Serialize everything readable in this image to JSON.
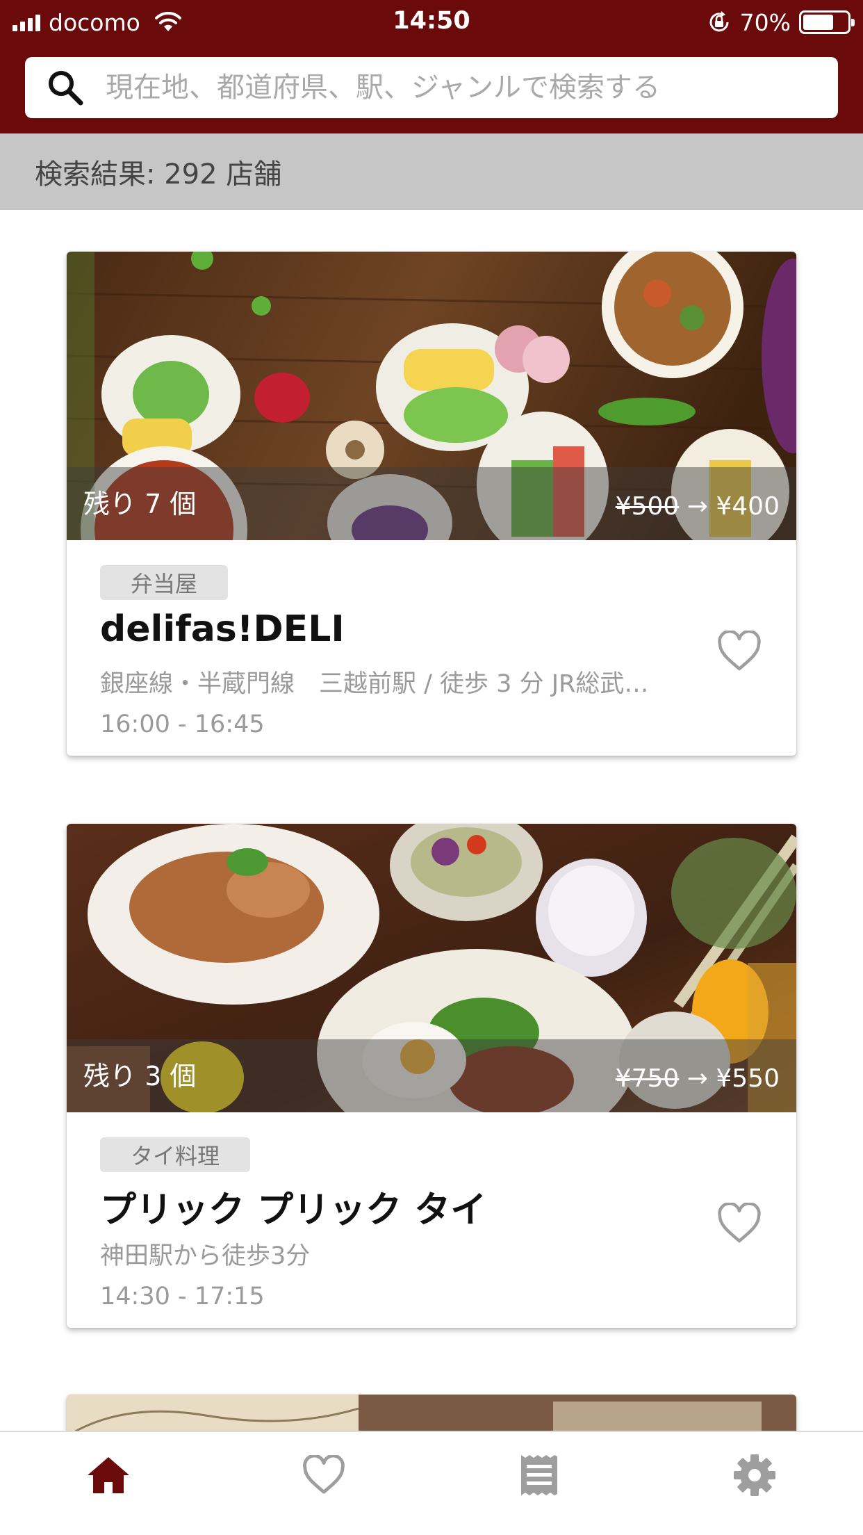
{
  "status_bar": {
    "carrier": "docomo",
    "time": "14:50",
    "battery": "70%",
    "battery_level": 0.7
  },
  "search": {
    "placeholder": "現在地、都道府県、駅、ジャンルで検索する"
  },
  "results": {
    "summary": "検索結果: 292 店舗"
  },
  "cards": [
    {
      "remaining": "残り 7 個",
      "price_old": "¥500",
      "arrow": "→",
      "price_new": "¥400",
      "genre": "弁当屋",
      "name": "delifas!DELI",
      "access": "銀座線・半蔵門線　三越前駅 / 徒歩 3 分 JR総武…",
      "hours": "16:00 - 16:45"
    },
    {
      "remaining": "残り 3 個",
      "price_old": "¥750",
      "arrow": "→",
      "price_new": "¥550",
      "genre": "タイ料理",
      "name": "プリック プリック タイ",
      "access": "神田駅から徒歩3分",
      "hours": "14:30 - 17:15"
    }
  ],
  "tab_bar": {
    "tabs": [
      "home-icon",
      "heart-icon",
      "receipt-icon",
      "gear-icon"
    ],
    "active": "home-icon"
  },
  "colors": {
    "brand": "#6b0a0a",
    "tab_inactive": "#9e9e9e",
    "result_bar": "#c6c6c6"
  }
}
